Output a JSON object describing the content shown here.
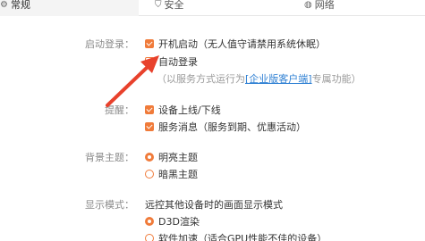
{
  "tabs": [
    {
      "label": "常规",
      "icon": "gear-icon"
    },
    {
      "label": "安全",
      "icon": "shield-icon"
    },
    {
      "label": "网络",
      "icon": "globe-icon"
    }
  ],
  "startup": {
    "label": "启动登录：",
    "boot_start": {
      "text": "开机启动（无人值守请禁用系统休眠）",
      "checked": true
    },
    "auto_login": {
      "text": "自动登录",
      "checked": false
    },
    "note_prefix": "（以服务方式运行为",
    "note_link": "[企业版客户端]",
    "note_suffix": "专属功能）"
  },
  "reminder": {
    "label": "提醒：",
    "device_online": {
      "text": "设备上线/下线",
      "checked": true
    },
    "service_msg": {
      "text": "服务消息（服务到期、优惠活动）",
      "checked": true
    }
  },
  "theme": {
    "label": "背景主题：",
    "options": [
      {
        "text": "明亮主题",
        "selected": true
      },
      {
        "text": "暗黑主题",
        "selected": false
      }
    ]
  },
  "display": {
    "label": "显示模式：",
    "desc": "远控其他设备时的画面显示模式",
    "options": [
      {
        "text": "D3D渲染",
        "selected": true
      },
      {
        "text": "软件加速（适合GPU性能不佳的设备）",
        "selected": false
      }
    ]
  },
  "colors": {
    "accent": "#f07b3a",
    "link": "#2d7fd3",
    "arrow": "#e8412c"
  }
}
